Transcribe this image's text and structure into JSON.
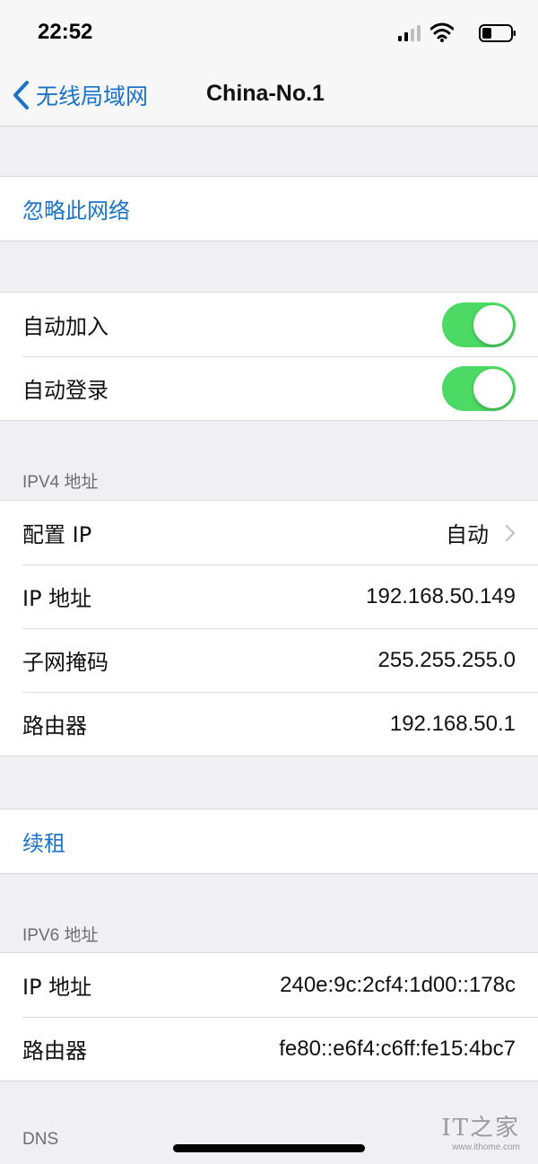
{
  "status_bar": {
    "time": "22:52",
    "icons": [
      "signal-icon",
      "wifi-icon",
      "battery-icon"
    ]
  },
  "nav": {
    "back_label": "无线局域网",
    "title": "China-No.1"
  },
  "forget": {
    "label": "忽略此网络"
  },
  "toggles": [
    {
      "label": "自动加入",
      "on": true
    },
    {
      "label": "自动登录",
      "on": true
    }
  ],
  "ipv4": {
    "header": "IPV4 地址",
    "rows": [
      {
        "label": "配置 IP",
        "value": "自动"
      },
      {
        "label": "IP 地址",
        "value": "192.168.50.149"
      },
      {
        "label": "子网掩码",
        "value": "255.255.255.0"
      },
      {
        "label": "路由器",
        "value": "192.168.50.1"
      }
    ]
  },
  "renew": {
    "label": "续租"
  },
  "ipv6": {
    "header": "IPV6 地址",
    "rows": [
      {
        "label": "IP 地址",
        "value": "240e:9c:2cf4:1d00::178c"
      },
      {
        "label": "路由器",
        "value": "fe80::e6f4:c6ff:fe15:4bc7"
      }
    ]
  },
  "dns": {
    "header": "DNS"
  },
  "watermark": {
    "logo": "IT之家",
    "url": "www.ithome.com"
  },
  "colors": {
    "accent": "#1a73c8",
    "toggle_on": "#4cd964",
    "background": "#efeff4"
  }
}
